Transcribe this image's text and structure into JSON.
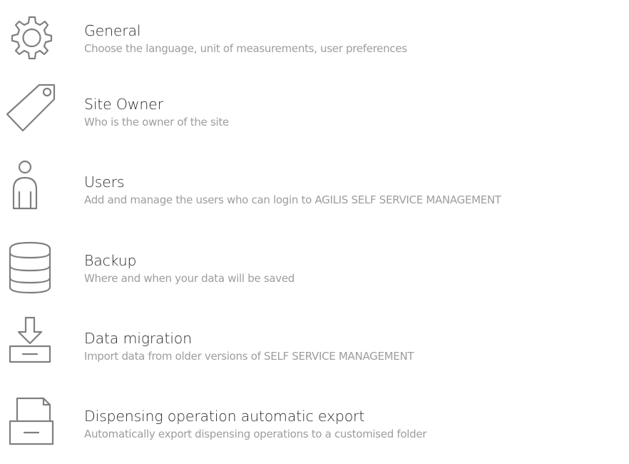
{
  "settings": {
    "items": [
      {
        "icon": "gear-icon",
        "title": "General",
        "description": "Choose the language, unit of measurements, user preferences"
      },
      {
        "icon": "tag-icon",
        "title": "Site Owner",
        "description": "Who is the owner of the site"
      },
      {
        "icon": "user-icon",
        "title": "Users",
        "description": "Add and manage the users who can login to AGILIS SELF SERVICE MANAGEMENT"
      },
      {
        "icon": "database-icon",
        "title": "Backup",
        "description": "Where and when your data will be saved"
      },
      {
        "icon": "import-tray-icon",
        "title": "Data migration",
        "description": "Import data from older versions of SELF SERVICE MANAGEMENT"
      },
      {
        "icon": "export-folder-icon",
        "title": "Dispensing operation automatic export",
        "description": "Automatically export dispensing operations to a customised folder"
      }
    ]
  },
  "colors": {
    "icon": "#7f7f7f",
    "title": "#2b2b2b",
    "description": "#9d9d9d",
    "background": "#ffffff"
  }
}
